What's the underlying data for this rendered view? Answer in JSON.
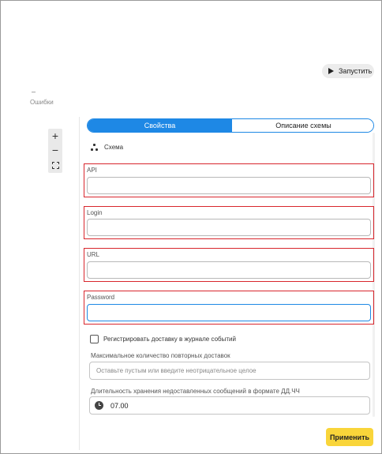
{
  "toolbar": {
    "run_label": "Запустить"
  },
  "status": {
    "dash": "–",
    "errors_label": "Ошибки"
  },
  "zoom": {
    "zoom_in": "+",
    "zoom_out": "−"
  },
  "tabs": [
    {
      "label": "Свойства",
      "active": true
    },
    {
      "label": "Описание схемы",
      "active": false
    }
  ],
  "schema": {
    "label": "Схема"
  },
  "fields": {
    "api": {
      "label": "API",
      "value": ""
    },
    "login": {
      "label": "Login",
      "value": ""
    },
    "url": {
      "label": "URL",
      "value": ""
    },
    "password": {
      "label": "Password",
      "value": ""
    }
  },
  "log_delivery": {
    "label": "Регистрировать доставку в журнале событий",
    "checked": false
  },
  "retries": {
    "label": "Максимальное количество повторных доставок",
    "placeholder": "Оставьте пустым или введите неотрицательное целое"
  },
  "retention": {
    "label": "Длительность хранения недоставленных сообщений в формате ДД.ЧЧ",
    "value": "07.00"
  },
  "apply_label": "Применить",
  "colors": {
    "accent": "#1e88e5",
    "highlight": "#d8262d",
    "apply": "#f9d53a"
  }
}
